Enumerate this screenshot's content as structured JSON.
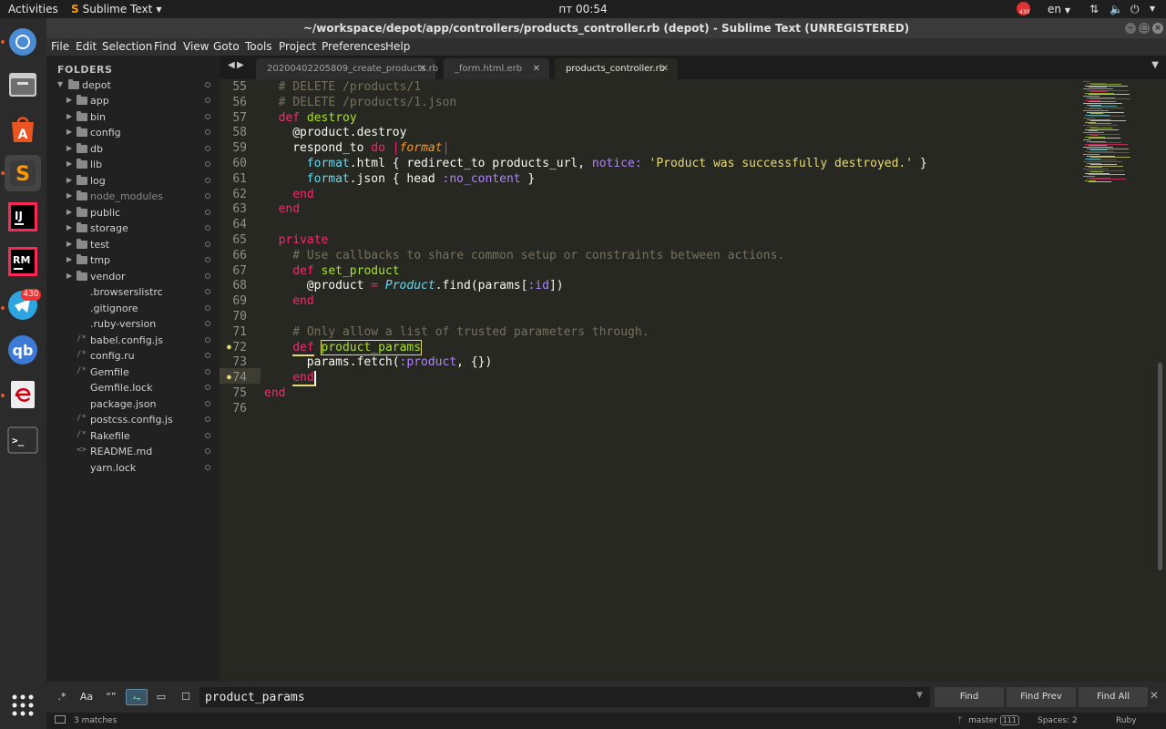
{
  "topbar": {
    "activities": "Activities",
    "app_name": "Sublime Text",
    "clock": "пт 00:54",
    "notification_count": "430",
    "language": "en"
  },
  "dock": {
    "telegram_badge": "430"
  },
  "window": {
    "title": "~/workspace/depot/app/controllers/products_controller.rb (depot) - Sublime Text (UNREGISTERED)"
  },
  "menu": [
    "File",
    "Edit",
    "Selection",
    "Find",
    "View",
    "Goto",
    "Tools",
    "Project",
    "Preferences",
    "Help"
  ],
  "sidebar": {
    "header": "FOLDERS",
    "root": "depot",
    "items": [
      {
        "label": "app",
        "kind": "folder",
        "muted": false
      },
      {
        "label": "bin",
        "kind": "folder",
        "muted": false
      },
      {
        "label": "config",
        "kind": "folder",
        "muted": false
      },
      {
        "label": "db",
        "kind": "folder",
        "muted": false
      },
      {
        "label": "lib",
        "kind": "folder",
        "muted": false
      },
      {
        "label": "log",
        "kind": "folder",
        "muted": false
      },
      {
        "label": "node_modules",
        "kind": "folder",
        "muted": true
      },
      {
        "label": "public",
        "kind": "folder",
        "muted": false
      },
      {
        "label": "storage",
        "kind": "folder",
        "muted": false
      },
      {
        "label": "test",
        "kind": "folder",
        "muted": false
      },
      {
        "label": "tmp",
        "kind": "folder",
        "muted": false
      },
      {
        "label": "vendor",
        "kind": "folder",
        "muted": false
      },
      {
        "label": ".browserslistrc",
        "kind": "file",
        "icon": ""
      },
      {
        "label": ".gitignore",
        "kind": "file",
        "icon": ""
      },
      {
        "label": ".ruby-version",
        "kind": "file",
        "icon": ""
      },
      {
        "label": "babel.config.js",
        "kind": "file",
        "icon": "/*"
      },
      {
        "label": "config.ru",
        "kind": "file",
        "icon": "/*"
      },
      {
        "label": "Gemfile",
        "kind": "file",
        "icon": "/*"
      },
      {
        "label": "Gemfile.lock",
        "kind": "file",
        "icon": ""
      },
      {
        "label": "package.json",
        "kind": "file",
        "icon": ""
      },
      {
        "label": "postcss.config.js",
        "kind": "file",
        "icon": "/*"
      },
      {
        "label": "Rakefile",
        "kind": "file",
        "icon": "/*"
      },
      {
        "label": "README.md",
        "kind": "file",
        "icon": "<>"
      },
      {
        "label": "yarn.lock",
        "kind": "file",
        "icon": ""
      }
    ]
  },
  "tabs": [
    {
      "label": "20200402205809_create_products.rb",
      "active": false
    },
    {
      "label": "_form.html.erb",
      "active": false
    },
    {
      "label": "products_controller.rb",
      "active": true
    }
  ],
  "editor": {
    "lines": [
      {
        "n": "55",
        "code": "# DELETE /products/1"
      },
      {
        "n": "56",
        "code": "# DELETE /products/1.json"
      },
      {
        "n": "57",
        "code": "def destroy"
      },
      {
        "n": "58",
        "code": "@product.destroy"
      },
      {
        "n": "59",
        "code": "respond_to do |format|"
      },
      {
        "n": "60",
        "code": "format.html { redirect_to products_url, notice: 'Product was successfully destroyed.' }"
      },
      {
        "n": "61",
        "code": "format.json { head :no_content }"
      },
      {
        "n": "62",
        "code": "end"
      },
      {
        "n": "63",
        "code": "end"
      },
      {
        "n": "64",
        "code": ""
      },
      {
        "n": "65",
        "code": "private"
      },
      {
        "n": "66",
        "code": "# Use callbacks to share common setup or constraints between actions."
      },
      {
        "n": "67",
        "code": "def set_product"
      },
      {
        "n": "68",
        "code": "@product = Product.find(params[:id])"
      },
      {
        "n": "69",
        "code": "end"
      },
      {
        "n": "70",
        "code": ""
      },
      {
        "n": "71",
        "code": "# Only allow a list of trusted parameters through."
      },
      {
        "n": "72",
        "code": "def product_params"
      },
      {
        "n": "73",
        "code": "params.fetch(:product, {})"
      },
      {
        "n": "74",
        "code": "end"
      },
      {
        "n": "75",
        "code": "end"
      },
      {
        "n": "76",
        "code": ""
      }
    ]
  },
  "find": {
    "regex": ".*",
    "case": "Aa",
    "whole_word": "“”",
    "query": "product_params",
    "find_label": "Find",
    "find_prev_label": "Find Prev",
    "find_all_label": "Find All"
  },
  "status": {
    "matches": "3 matches",
    "branch": "master",
    "branch_count": "111",
    "indent": "Spaces: 2",
    "syntax": "Ruby"
  },
  "colors": {
    "background": "#272822",
    "keyword": "#f92672",
    "function": "#a6e22e",
    "comment": "#75715e",
    "string": "#e6db74",
    "symbol": "#ae81ff"
  }
}
